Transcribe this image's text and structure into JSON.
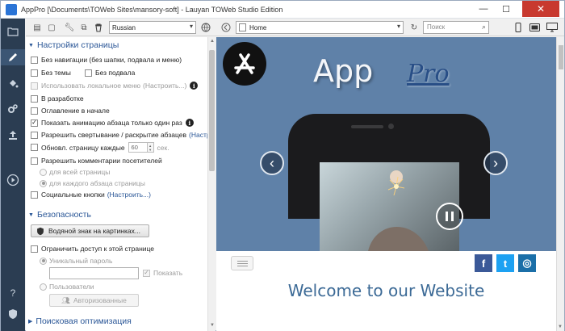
{
  "window": {
    "title": "AppPro [\\Documents\\TOWeb Sites\\mansory-soft] - Lauyan TOWeb Studio Edition",
    "minimize": "—",
    "maximize": "☐",
    "close": "✕"
  },
  "toolbar": {
    "language": "Russian",
    "url": "Home",
    "search_placeholder": "Поиск"
  },
  "settings": {
    "section_title": "Настройки страницы",
    "no_navigation": "Без навигации (без шапки, подвала и меню)",
    "no_theme": "Без темы",
    "no_footer": "Без подвала",
    "use_local_menu": "Использовать локальное меню",
    "use_local_menu_link": "(Настроить...)",
    "in_development": "В разработке",
    "toc_at_start": "Оглавление в начале",
    "show_animation_once": "Показать анимацию абзаца только один раз",
    "allow_collapse": "Разрешить свертывание / раскрытие абзацев",
    "allow_collapse_link": "(Настро",
    "refresh_every": "Обновл. страницу каждые",
    "refresh_value": "60",
    "refresh_unit": "сек.",
    "allow_comments": "Разрешить комментарии посетителей",
    "for_whole_page": "для всей страницы",
    "for_each_paragraph": "для каждого абзаца страницы",
    "social_buttons": "Социальные кнопки",
    "social_buttons_link": "(Настроить...)"
  },
  "security": {
    "section_title": "Безопасность",
    "watermark_button": "Водяной знак на картинках...",
    "restrict_access": "Ограничить доступ к этой странице",
    "unique_password": "Уникальный пароль",
    "show": "Показать",
    "users": "Пользователи",
    "authorized_button": "Авторизованные"
  },
  "seo": {
    "section_title": "Поисковая оптимизация"
  },
  "preview": {
    "title_app": "App",
    "title_pro": "Pro",
    "welcome": "Welcome to our Website",
    "prev_arrow": "‹",
    "next_arrow": "›",
    "social": [
      "f",
      "t",
      "◎"
    ]
  },
  "colors": {
    "sidebar": "#2b3d52",
    "section_title": "#2b5797",
    "preview_bg": "#5f81a8",
    "facebook": "#3b5998",
    "twitter": "#1da1f2",
    "instagram": "#1b6fa8",
    "welcome_text": "#3c6a96"
  }
}
